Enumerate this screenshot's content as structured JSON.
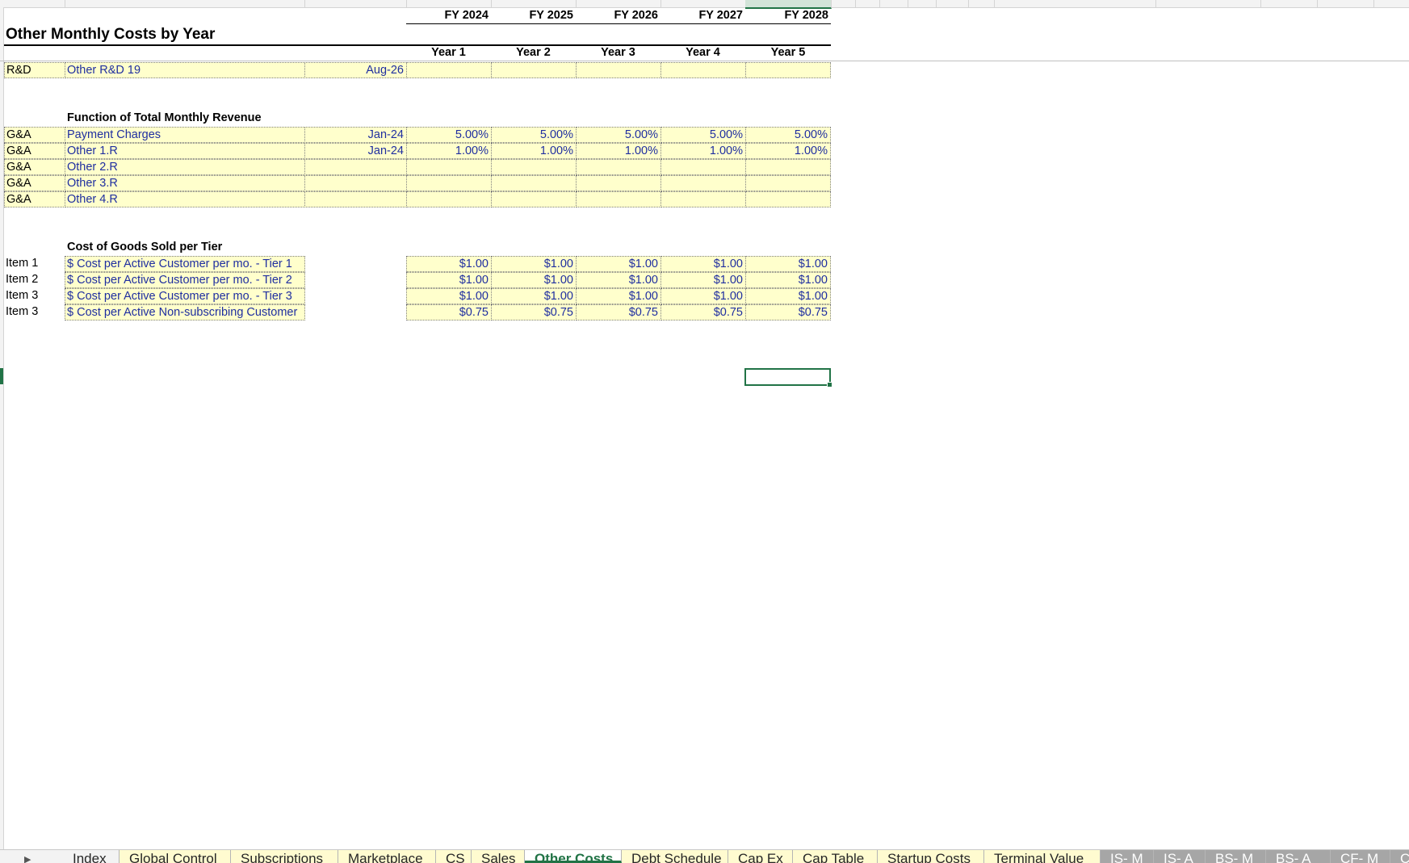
{
  "sheet": {
    "title": "Other Monthly Costs by Year",
    "fiscal_years": [
      "FY 2024",
      "FY 2025",
      "FY 2026",
      "FY 2027",
      "FY 2028"
    ],
    "year_labels": [
      "Year 1",
      "Year 2",
      "Year 3",
      "Year 4",
      "Year 5"
    ]
  },
  "rd_row": {
    "dept": "R&D",
    "name": "Other R&D 19",
    "date": "Aug-26",
    "values": [
      "",
      "",
      "",
      "",
      ""
    ]
  },
  "revenue_section": {
    "header": "Function of Total Monthly Revenue",
    "rows": [
      {
        "dept": "G&A",
        "name": "Payment Charges",
        "date": "Jan-24",
        "values": [
          "5.00%",
          "5.00%",
          "5.00%",
          "5.00%",
          "5.00%"
        ]
      },
      {
        "dept": "G&A",
        "name": "Other 1.R",
        "date": "Jan-24",
        "values": [
          "1.00%",
          "1.00%",
          "1.00%",
          "1.00%",
          "1.00%"
        ]
      },
      {
        "dept": "G&A",
        "name": "Other 2.R",
        "date": "",
        "values": [
          "",
          "",
          "",
          "",
          ""
        ]
      },
      {
        "dept": "G&A",
        "name": "Other 3.R",
        "date": "",
        "values": [
          "",
          "",
          "",
          "",
          ""
        ]
      },
      {
        "dept": "G&A",
        "name": "Other 4.R",
        "date": "",
        "values": [
          "",
          "",
          "",
          "",
          ""
        ]
      }
    ]
  },
  "cogs_section": {
    "header": "Cost of Goods Sold per Tier",
    "rows": [
      {
        "item": "Item 1",
        "name": "$ Cost per Active Customer per mo. - Tier 1",
        "values": [
          "$1.00",
          "$1.00",
          "$1.00",
          "$1.00",
          "$1.00"
        ]
      },
      {
        "item": "Item 2",
        "name": "$ Cost per Active Customer per mo. - Tier 2",
        "values": [
          "$1.00",
          "$1.00",
          "$1.00",
          "$1.00",
          "$1.00"
        ]
      },
      {
        "item": "Item 3",
        "name": "$ Cost per Active Customer per mo. - Tier 3",
        "values": [
          "$1.00",
          "$1.00",
          "$1.00",
          "$1.00",
          "$1.00"
        ]
      },
      {
        "item": "Item 3",
        "name": "$ Cost per Active Non-subscribing Customer",
        "values": [
          "$0.75",
          "$0.75",
          "$0.75",
          "$0.75",
          "$0.75"
        ]
      }
    ]
  },
  "tabs": [
    {
      "label": "Index",
      "style": "plain"
    },
    {
      "label": "Global Control",
      "style": "yel"
    },
    {
      "label": "Subscriptions",
      "style": "yel"
    },
    {
      "label": "Marketplace",
      "style": "yel"
    },
    {
      "label": "CS",
      "style": "yel"
    },
    {
      "label": "Sales",
      "style": "yel"
    },
    {
      "label": "Other Costs",
      "style": "active"
    },
    {
      "label": "Debt Schedule",
      "style": "yel"
    },
    {
      "label": "Cap Ex",
      "style": "yel"
    },
    {
      "label": "Cap Table",
      "style": "yel"
    },
    {
      "label": "Startup Costs",
      "style": "yel"
    },
    {
      "label": "Terminal Value",
      "style": "yel"
    },
    {
      "label": "IS- M",
      "style": "grey"
    },
    {
      "label": "IS- A",
      "style": "grey"
    },
    {
      "label": "BS- M",
      "style": "grey"
    },
    {
      "label": "BS- A",
      "style": "grey"
    },
    {
      "label": "CF- M",
      "style": "grey"
    },
    {
      "label": "CF",
      "style": "grey"
    }
  ],
  "icons": {
    "scroll_next": "triangle-right-icon"
  },
  "colors": {
    "input_fill": "#ffffcc",
    "input_text": "#1f2ea0",
    "excel_green": "#217346"
  }
}
